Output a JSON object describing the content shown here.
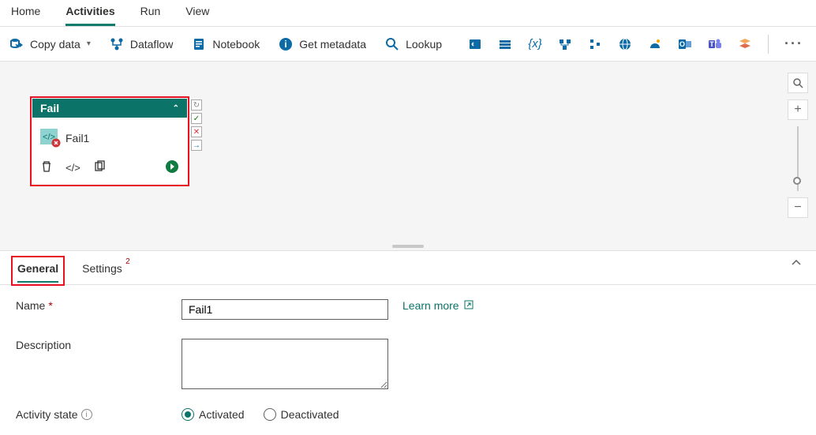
{
  "top_tabs": {
    "home": "Home",
    "activities": "Activities",
    "run": "Run",
    "view": "View"
  },
  "toolbar": {
    "copy_data": "Copy data",
    "dataflow": "Dataflow",
    "notebook": "Notebook",
    "get_metadata": "Get metadata",
    "lookup": "Lookup"
  },
  "node": {
    "header": "Fail",
    "name": "Fail1"
  },
  "prop_tabs": {
    "general": "General",
    "settings": "Settings",
    "settings_badge": "2"
  },
  "props": {
    "name_label": "Name",
    "name_value": "Fail1",
    "learn_more": "Learn more",
    "description_label": "Description",
    "description_value": "",
    "activity_state_label": "Activity state",
    "activated": "Activated",
    "deactivated": "Deactivated"
  }
}
